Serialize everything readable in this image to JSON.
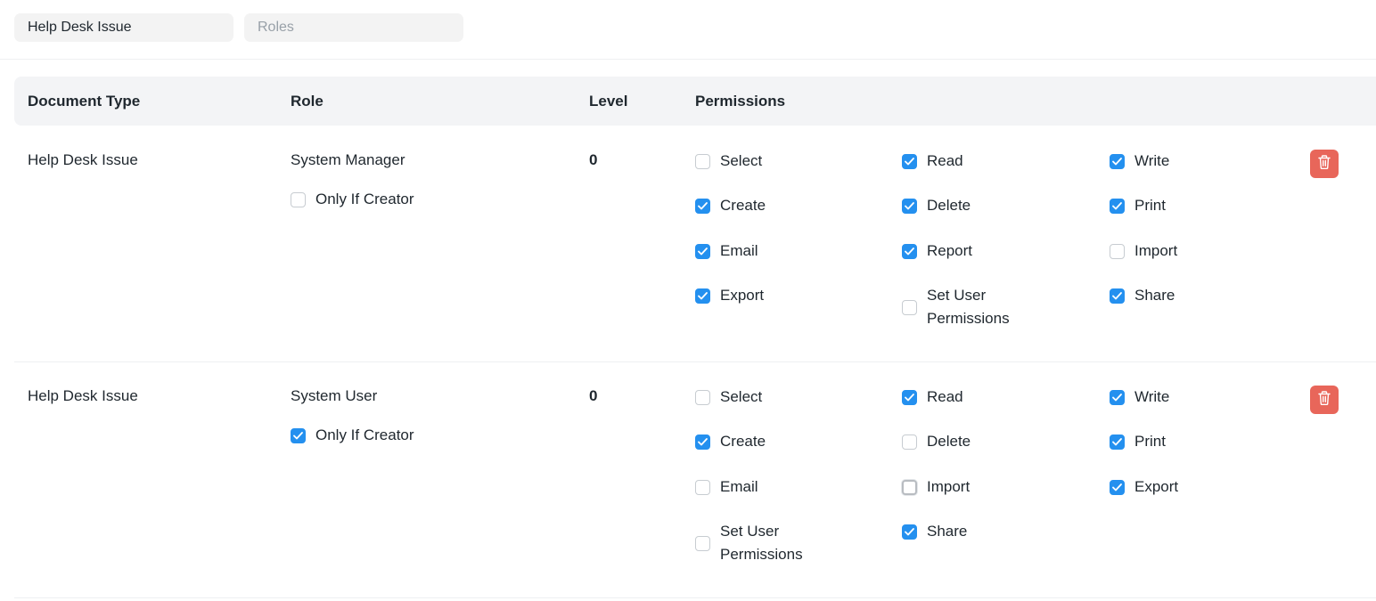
{
  "filters": {
    "doctype_value": "Help Desk Issue",
    "role_placeholder": "Roles"
  },
  "table": {
    "headers": {
      "document_type": "Document Type",
      "role": "Role",
      "level": "Level",
      "permissions": "Permissions"
    },
    "rows": [
      {
        "document_type": "Help Desk Issue",
        "role": "System Manager",
        "only_if_creator": {
          "label": "Only If Creator",
          "checked": false
        },
        "level": "0",
        "permissions": [
          {
            "label": "Select",
            "checked": false
          },
          {
            "label": "Read",
            "checked": true
          },
          {
            "label": "Write",
            "checked": true
          },
          {
            "label": "Create",
            "checked": true
          },
          {
            "label": "Delete",
            "checked": true
          },
          {
            "label": "Print",
            "checked": true
          },
          {
            "label": "Email",
            "checked": true
          },
          {
            "label": "Report",
            "checked": true
          },
          {
            "label": "Import",
            "checked": false
          },
          {
            "label": "Export",
            "checked": true
          },
          {
            "label": "Set User\nPermissions",
            "checked": false
          },
          {
            "label": "Share",
            "checked": true
          }
        ],
        "delete_icon": "trash-icon"
      },
      {
        "document_type": "Help Desk Issue",
        "role": "System User",
        "only_if_creator": {
          "label": "Only If Creator",
          "checked": true
        },
        "level": "0",
        "permissions": [
          {
            "label": "Select",
            "checked": false
          },
          {
            "label": "Read",
            "checked": true
          },
          {
            "label": "Write",
            "checked": true
          },
          {
            "label": "Create",
            "checked": true
          },
          {
            "label": "Delete",
            "checked": false
          },
          {
            "label": "Print",
            "checked": true
          },
          {
            "label": "Email",
            "checked": false
          },
          {
            "label": "Import",
            "checked": false,
            "focused": true
          },
          {
            "label": "Export",
            "checked": true
          },
          {
            "label": "Set User\nPermissions",
            "checked": false
          },
          {
            "label": "Share",
            "checked": true
          }
        ],
        "delete_icon": "trash-icon"
      }
    ]
  },
  "colors": {
    "accent": "#2490ef",
    "danger": "#e8665a"
  }
}
